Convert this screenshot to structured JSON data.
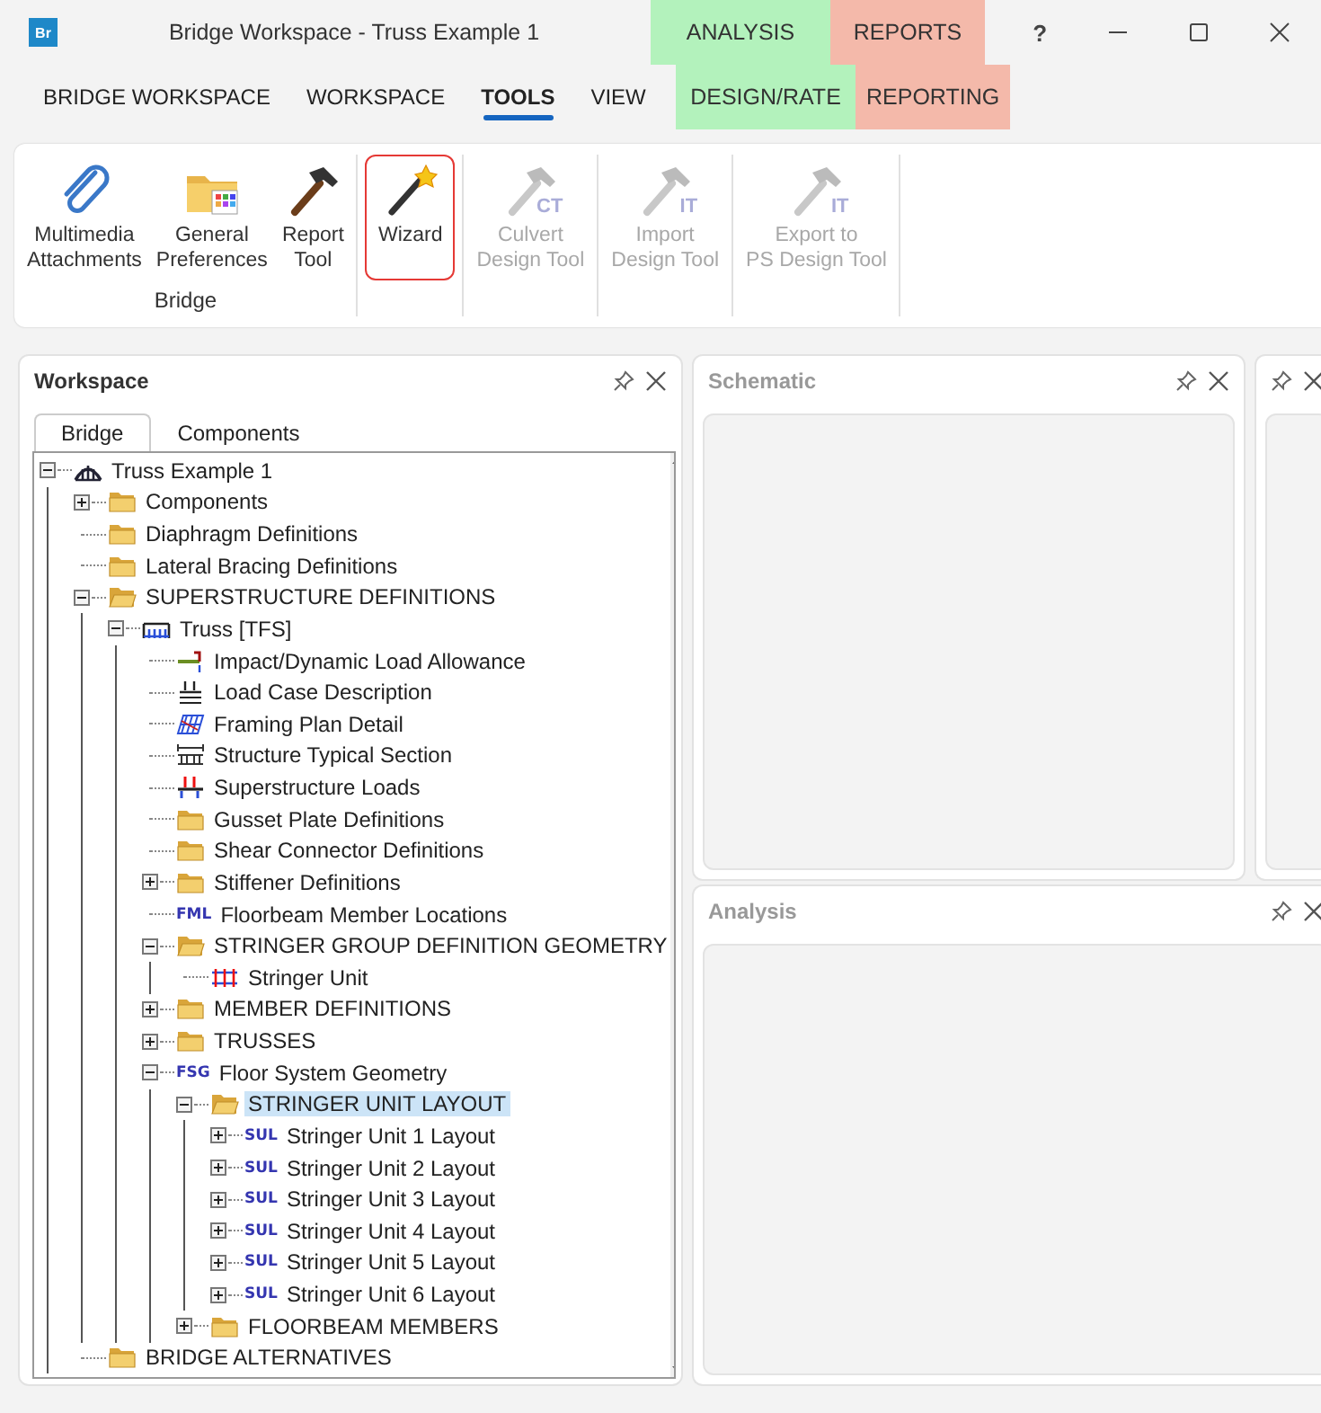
{
  "window": {
    "logo": "Br",
    "title": "Bridge Workspace - Truss Example 1",
    "help": "?"
  },
  "tabs": [
    {
      "label": "BRIDGE WORKSPACE",
      "selected": false
    },
    {
      "label": "WORKSPACE",
      "selected": false
    },
    {
      "label": "TOOLS",
      "selected": true
    },
    {
      "label": "VIEW",
      "selected": false
    }
  ],
  "context_groups": [
    {
      "label": "ANALYSIS",
      "color": "#b3f2bc",
      "tab": {
        "label": "DESIGN/RATE",
        "selected": false
      }
    },
    {
      "label": "REPORTS",
      "color": "#f4b9aa",
      "tab": {
        "label": "REPORTING",
        "selected": false
      }
    }
  ],
  "ribbon_groups": [
    {
      "label": "Bridge",
      "buttons": [
        {
          "kind": "paperclip",
          "lines": [
            "Multimedia",
            "Attachments"
          ],
          "disabled": false,
          "highlighted": false
        },
        {
          "kind": "folder",
          "lines": [
            "General",
            "Preferences"
          ],
          "disabled": false,
          "highlighted": false
        },
        {
          "kind": "hammer",
          "lines": [
            "Report",
            "Tool"
          ],
          "disabled": false,
          "highlighted": false
        }
      ]
    },
    {
      "buttons": [
        {
          "kind": "wand",
          "lines": [
            "Wizard"
          ],
          "disabled": false,
          "highlighted": true
        }
      ]
    },
    {
      "buttons": [
        {
          "kind": "hammer",
          "badge": "CT",
          "lines": [
            "Culvert",
            "Design Tool"
          ],
          "disabled": true,
          "highlighted": false
        }
      ]
    },
    {
      "buttons": [
        {
          "kind": "hammer",
          "badge": "IT",
          "lines": [
            "Import",
            "Design Tool"
          ],
          "disabled": true,
          "highlighted": false
        }
      ]
    },
    {
      "buttons": [
        {
          "kind": "hammer",
          "badge": "IT",
          "lines": [
            "Export to",
            "PS Design Tool"
          ],
          "disabled": true,
          "highlighted": false
        }
      ]
    }
  ],
  "workspace": {
    "title": "Workspace",
    "tabs": [
      {
        "label": "Bridge",
        "selected": true
      },
      {
        "label": "Components",
        "selected": false
      }
    ],
    "tree": [
      {
        "label": "Truss Example 1",
        "kind": "bridge",
        "expanded": true,
        "selected": false,
        "children": [
          {
            "label": "Components",
            "kind": "folder",
            "expanded": false,
            "selected": false
          },
          {
            "label": "Diaphragm Definitions",
            "kind": "folder",
            "selected": false
          },
          {
            "label": "Lateral Bracing Definitions",
            "kind": "folder",
            "selected": false
          },
          {
            "label": "SUPERSTRUCTURE DEFINITIONS",
            "kind": "folder",
            "expanded": true,
            "selected": false,
            "children": [
              {
                "label": "Truss [TFS]",
                "kind": "truss",
                "expanded": true,
                "selected": false,
                "children": [
                  {
                    "label": "Impact/Dynamic Load Allowance",
                    "kind": "impact",
                    "selected": false
                  },
                  {
                    "label": "Load Case Description",
                    "kind": "loadcase",
                    "selected": false
                  },
                  {
                    "label": "Framing Plan Detail",
                    "kind": "framing",
                    "selected": false
                  },
                  {
                    "label": "Structure Typical Section",
                    "kind": "section",
                    "selected": false
                  },
                  {
                    "label": "Superstructure Loads",
                    "kind": "loads",
                    "selected": false
                  },
                  {
                    "label": "Gusset Plate Definitions",
                    "kind": "folder",
                    "selected": false
                  },
                  {
                    "label": "Shear Connector Definitions",
                    "kind": "folder",
                    "selected": false
                  },
                  {
                    "label": "Stiffener Definitions",
                    "kind": "folder",
                    "expanded": false,
                    "selected": false
                  },
                  {
                    "label": "Floorbeam Member Locations",
                    "kind": "badge",
                    "badge": "FML",
                    "selected": false
                  },
                  {
                    "label": "STRINGER GROUP DEFINITION GEOMETRY",
                    "kind": "folder",
                    "expanded": true,
                    "selected": false,
                    "children": [
                      {
                        "label": "Stringer Unit",
                        "kind": "stringer",
                        "selected": false
                      }
                    ]
                  },
                  {
                    "label": "MEMBER DEFINITIONS",
                    "kind": "folder",
                    "expanded": false,
                    "selected": false
                  },
                  {
                    "label": "TRUSSES",
                    "kind": "folder",
                    "expanded": false,
                    "selected": false
                  },
                  {
                    "label": "Floor System Geometry",
                    "kind": "badge",
                    "badge": "FSG",
                    "expanded": true,
                    "selected": false,
                    "children": [
                      {
                        "label": "STRINGER UNIT LAYOUT",
                        "kind": "folder",
                        "expanded": true,
                        "selected": true,
                        "children": [
                          {
                            "label": "Stringer Unit 1 Layout",
                            "kind": "badge",
                            "badge": "SUL",
                            "expanded": false,
                            "selected": false
                          },
                          {
                            "label": "Stringer Unit 2 Layout",
                            "kind": "badge",
                            "badge": "SUL",
                            "expanded": false,
                            "selected": false
                          },
                          {
                            "label": "Stringer Unit 3 Layout",
                            "kind": "badge",
                            "badge": "SUL",
                            "expanded": false,
                            "selected": false
                          },
                          {
                            "label": "Stringer Unit 4 Layout",
                            "kind": "badge",
                            "badge": "SUL",
                            "expanded": false,
                            "selected": false
                          },
                          {
                            "label": "Stringer Unit 5 Layout",
                            "kind": "badge",
                            "badge": "SUL",
                            "expanded": false,
                            "selected": false
                          },
                          {
                            "label": "Stringer Unit 6 Layout",
                            "kind": "badge",
                            "badge": "SUL",
                            "expanded": false,
                            "selected": false
                          }
                        ]
                      },
                      {
                        "label": "FLOORBEAM MEMBERS",
                        "kind": "folder",
                        "expanded": false,
                        "selected": false
                      }
                    ]
                  }
                ]
              }
            ]
          },
          {
            "label": "BRIDGE ALTERNATIVES",
            "kind": "folder",
            "selected": false
          }
        ]
      }
    ]
  },
  "panels": [
    {
      "title": "Schematic"
    },
    {
      "title": "Analysis"
    }
  ]
}
